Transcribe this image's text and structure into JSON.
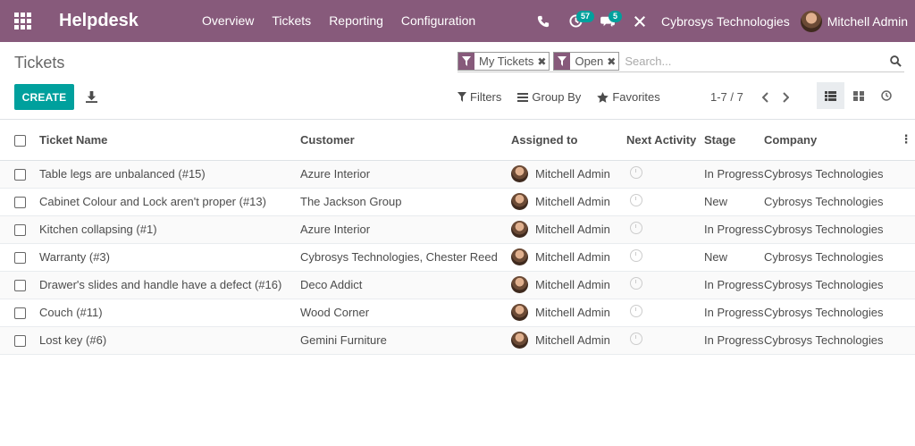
{
  "navbar": {
    "app_name": "Helpdesk",
    "menu": [
      "Overview",
      "Tickets",
      "Reporting",
      "Configuration"
    ],
    "activity_count": "57",
    "messages_count": "5",
    "company": "Cybrosys Technologies",
    "user": "Mitchell Admin"
  },
  "control_panel": {
    "breadcrumb": "Tickets",
    "facets": [
      "My Tickets",
      "Open"
    ],
    "search_placeholder": "Search...",
    "create_label": "CREATE",
    "filters_label": "Filters",
    "groupby_label": "Group By",
    "favorites_label": "Favorites",
    "pager": "1-7 / 7"
  },
  "table": {
    "columns": [
      "Ticket Name",
      "Customer",
      "Assigned to",
      "Next Activity",
      "Stage",
      "Company"
    ],
    "rows": [
      {
        "name": "Table legs are unbalanced (#15)",
        "customer": "Azure Interior",
        "assigned": "Mitchell Admin",
        "stage": "In Progress",
        "company": "Cybrosys Technologies"
      },
      {
        "name": "Cabinet Colour and Lock aren't proper (#13)",
        "customer": "The Jackson Group",
        "assigned": "Mitchell Admin",
        "stage": "New",
        "company": "Cybrosys Technologies"
      },
      {
        "name": "Kitchen collapsing (#1)",
        "customer": "Azure Interior",
        "assigned": "Mitchell Admin",
        "stage": "In Progress",
        "company": "Cybrosys Technologies"
      },
      {
        "name": "Warranty (#3)",
        "customer": "Cybrosys Technologies, Chester Reed",
        "assigned": "Mitchell Admin",
        "stage": "New",
        "company": "Cybrosys Technologies"
      },
      {
        "name": "Drawer's slides and handle have a defect (#16)",
        "customer": "Deco Addict",
        "assigned": "Mitchell Admin",
        "stage": "In Progress",
        "company": "Cybrosys Technologies"
      },
      {
        "name": "Couch (#11)",
        "customer": "Wood Corner",
        "assigned": "Mitchell Admin",
        "stage": "In Progress",
        "company": "Cybrosys Technologies"
      },
      {
        "name": "Lost key (#6)",
        "customer": "Gemini Furniture",
        "assigned": "Mitchell Admin",
        "stage": "In Progress",
        "company": "Cybrosys Technologies"
      }
    ]
  },
  "colors": {
    "brand": "#875a7b",
    "primary": "#00a09d"
  }
}
